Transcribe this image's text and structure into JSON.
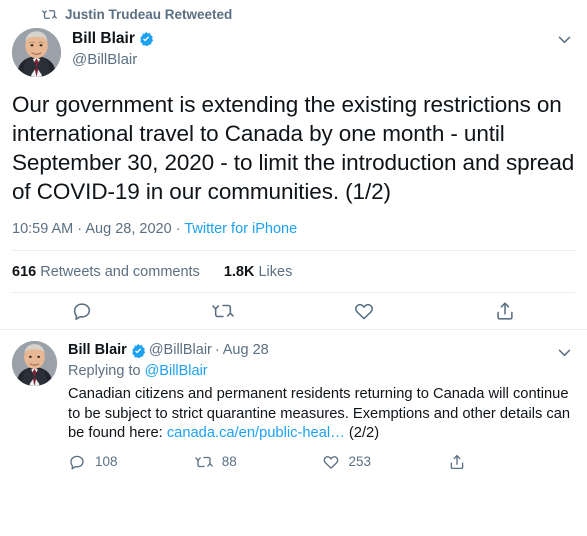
{
  "retweet_context": {
    "icon": "retweet-icon",
    "label": "Justin Trudeau Retweeted"
  },
  "main_tweet": {
    "author": {
      "display_name": "Bill Blair",
      "handle": "@BillBlair",
      "verified": true,
      "verified_icon": "verified-badge-icon",
      "avatar_alt": "Bill Blair profile photo"
    },
    "menu_icon": "chevron-down-icon",
    "text": "Our government is extending the existing restrictions on international travel to Canada by one month - until September 30, 2020 - to limit the introduction and spread of COVID-19 in our communities. (1/2)",
    "meta": {
      "time": "10:59 AM",
      "separator": "·",
      "date": "Aug 28, 2020",
      "source": "Twitter for iPhone"
    },
    "stats": {
      "retweets_count": "616",
      "retweets_label": "Retweets and comments",
      "likes_count": "1.8K",
      "likes_label": "Likes"
    },
    "actions": [
      {
        "name": "reply-action",
        "icon": "reply-icon"
      },
      {
        "name": "retweet-action",
        "icon": "retweet-icon"
      },
      {
        "name": "like-action",
        "icon": "heart-icon"
      },
      {
        "name": "share-action",
        "icon": "share-icon"
      }
    ]
  },
  "reply_tweet": {
    "author": {
      "display_name": "Bill Blair",
      "handle": "@BillBlair",
      "verified": true,
      "verified_icon": "verified-badge-icon",
      "avatar_alt": "Bill Blair profile photo"
    },
    "separator": "·",
    "date": "Aug 28",
    "menu_icon": "chevron-down-icon",
    "replying_to_label": "Replying to",
    "replying_to_handle": "@BillBlair",
    "text_before_link": "Canadian citizens and permanent residents returning to Canada will continue to be subject to strict quarantine measures. Exemptions and other details can be found here: ",
    "link_text": "canada.ca/en/public-heal…",
    "text_after_link": " (2/2)",
    "actions": [
      {
        "name": "reply-action",
        "icon": "reply-icon",
        "count": "108"
      },
      {
        "name": "retweet-action",
        "icon": "retweet-icon",
        "count": "88"
      },
      {
        "name": "like-action",
        "icon": "heart-icon",
        "count": "253"
      },
      {
        "name": "share-action",
        "icon": "share-icon",
        "count": ""
      }
    ]
  },
  "colors": {
    "brand_blue": "#1DA1F2",
    "text_primary": "#0F1419",
    "text_secondary": "#5B7083",
    "divider": "#EBEEF0",
    "background": "#FFFFFF"
  }
}
